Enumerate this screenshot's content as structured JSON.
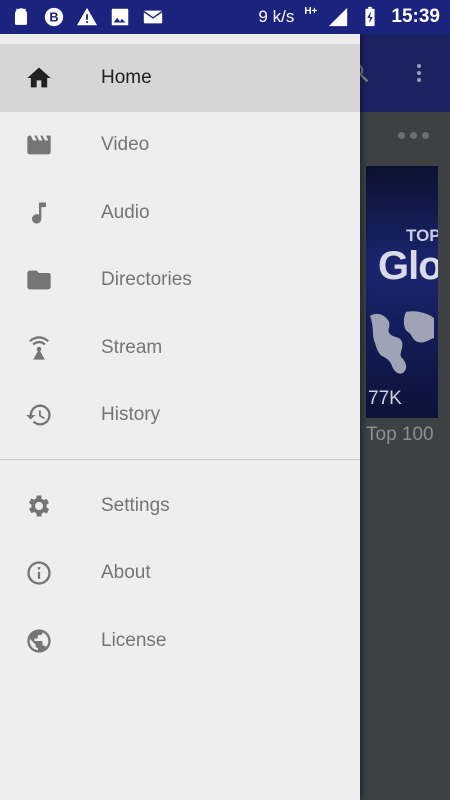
{
  "status_bar": {
    "left_icons": [
      "android-icon",
      "b-app-icon",
      "warning-icon",
      "image-icon",
      "email-icon"
    ],
    "speed": "9 k/s",
    "network": "H+",
    "time": "15:39"
  },
  "background_app": {
    "thumbnail_text_top": "TOP",
    "thumbnail_text_main": "Glo",
    "thumbnail_views": "77K",
    "thumbnail_title": "Top 100"
  },
  "drawer": {
    "primary_items": [
      {
        "label": "Home",
        "icon": "home-icon",
        "selected": true
      },
      {
        "label": "Video",
        "icon": "movie-icon",
        "selected": false
      },
      {
        "label": "Audio",
        "icon": "music-note-icon",
        "selected": false
      },
      {
        "label": "Directories",
        "icon": "folder-icon",
        "selected": false
      },
      {
        "label": "Stream",
        "icon": "antenna-icon",
        "selected": false
      },
      {
        "label": "History",
        "icon": "history-icon",
        "selected": false
      }
    ],
    "secondary_items": [
      {
        "label": "Settings",
        "icon": "gear-icon"
      },
      {
        "label": "About",
        "icon": "info-icon"
      },
      {
        "label": "License",
        "icon": "globe-icon"
      }
    ]
  },
  "colors": {
    "status_bar": "#1a237e",
    "drawer_bg": "#eeeeee",
    "selected_bg": "#d6d6d6",
    "text_selected": "#212121",
    "text_normal": "#757575"
  }
}
